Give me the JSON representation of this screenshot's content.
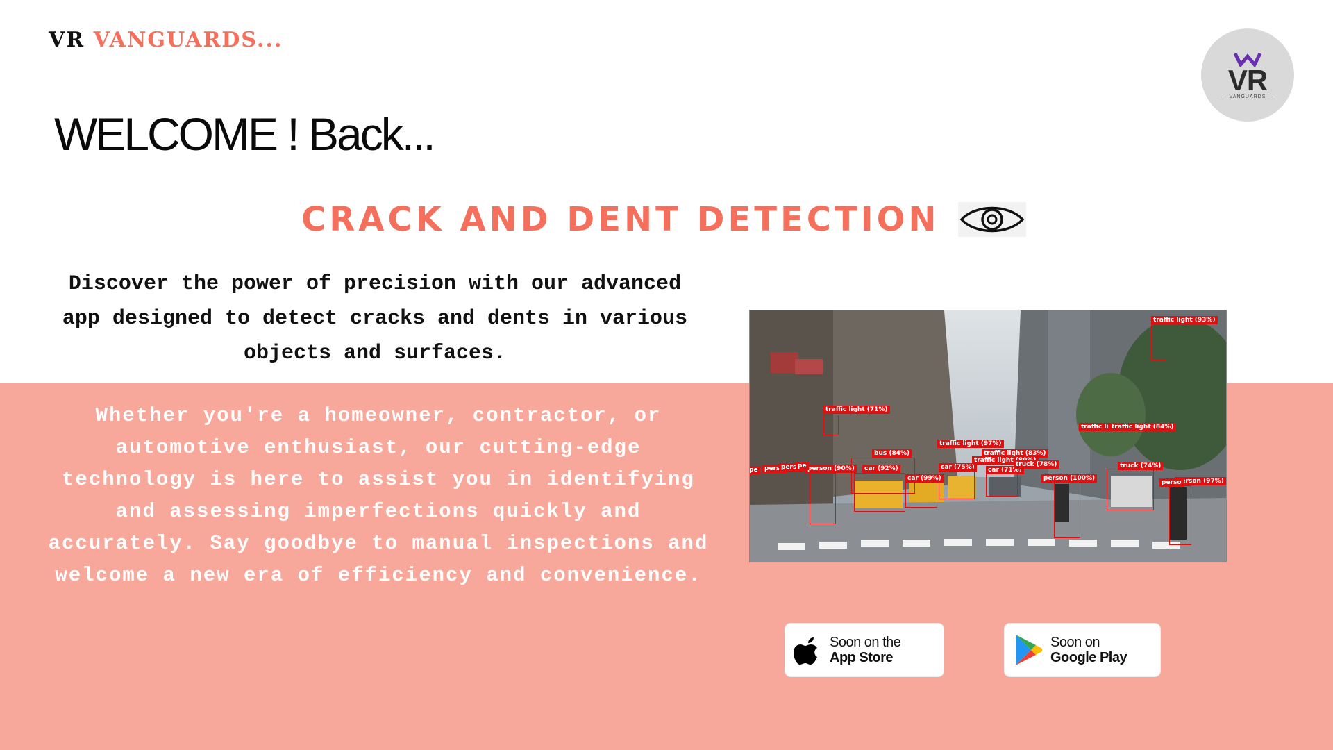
{
  "brand": {
    "part1": "VR",
    "part2": "VANGUARDS..."
  },
  "logo": {
    "initials": "VR",
    "subtitle": "— VANGUARDS —"
  },
  "welcome": "WELCOME ! Back...",
  "headline": "CRACK AND DENT DETECTION",
  "intro": "Discover the power of precision with our advanced app designed to detect cracks and dents in various objects and surfaces.",
  "body": "Whether you're a homeowner, contractor, or automotive enthusiast, our cutting-edge technology is here to assist you in identifying and assessing imperfections quickly and accurately. Say goodbye to manual inspections and welcome a new era of efficiency and convenience.",
  "detection_labels": [
    "traffic light (93%)",
    "traffic light (71%)",
    "traffic light (97%)",
    "traffic lig",
    "traffic light (84%)",
    "traffic light (83%)",
    "traffic light (80%)",
    "bus (84%)",
    "car (92%)",
    "car (99%)",
    "car (75%)",
    "car (71%)",
    "truck (78%)",
    "truck (74%)",
    "person (90%)",
    "person (100%)",
    "person (97%)",
    "pe",
    "pe",
    "perso",
    "perso",
    "pe",
    "perso"
  ],
  "stores": {
    "apple": {
      "line1": "Soon on the",
      "line2": "App Store"
    },
    "google": {
      "line1": "Soon on",
      "line2": "Google Play"
    }
  },
  "colors": {
    "accent": "#f4705c",
    "band": "#f8a79b",
    "logo_bg": "#d9d9d9",
    "logo_mark": "#6a2fb0"
  },
  "icons": [
    "eye-icon",
    "apple-icon",
    "google-play-icon",
    "vr-logo-icon"
  ]
}
